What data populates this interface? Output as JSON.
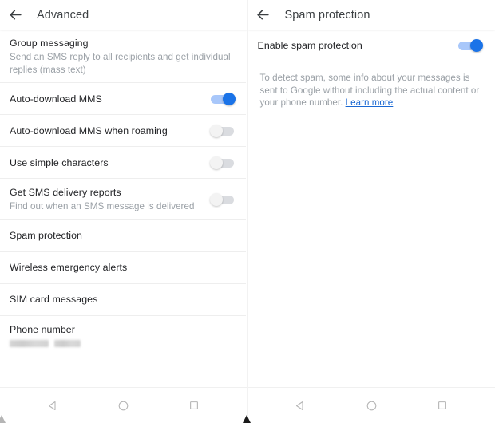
{
  "left_panel": {
    "appbar": {
      "back_icon": "arrow-back-icon",
      "title": "Advanced"
    },
    "rows": [
      {
        "name": "group-messaging",
        "title": "Group messaging",
        "subtitle": "Send an SMS reply to all recipients and get individual replies (mass text)",
        "control": "none"
      },
      {
        "name": "auto-download-mms",
        "title": "Auto-download MMS",
        "subtitle": "",
        "control": "switch",
        "switch_state": "on"
      },
      {
        "name": "auto-download-mms-roaming",
        "title": "Auto-download MMS when roaming",
        "subtitle": "",
        "control": "switch",
        "switch_state": "off"
      },
      {
        "name": "use-simple-characters",
        "title": "Use simple characters",
        "subtitle": "",
        "control": "switch",
        "switch_state": "off"
      },
      {
        "name": "get-sms-delivery-reports",
        "title": "Get SMS delivery reports",
        "subtitle": "Find out when an SMS message is delivered",
        "control": "switch",
        "switch_state": "off"
      },
      {
        "name": "spam-protection",
        "title": "Spam protection",
        "subtitle": "",
        "control": "none"
      },
      {
        "name": "wireless-emergency-alerts",
        "title": "Wireless emergency alerts",
        "subtitle": "",
        "control": "none"
      },
      {
        "name": "sim-card-messages",
        "title": "SIM card messages",
        "subtitle": "",
        "control": "none"
      },
      {
        "name": "phone-number",
        "title": "Phone number",
        "subtitle": "",
        "control": "redacted"
      }
    ]
  },
  "right_panel": {
    "appbar": {
      "back_icon": "arrow-back-icon",
      "title": "Spam protection"
    },
    "rows": [
      {
        "name": "enable-spam-protection",
        "title": "Enable spam protection",
        "subtitle": "",
        "control": "switch",
        "switch_state": "on"
      }
    ],
    "info": {
      "text": "To detect spam, some info about your messages is sent to Google without including the actual content or your phone number. ",
      "link_label": "Learn more"
    }
  },
  "navbar": {
    "back_label": "Back",
    "home_label": "Home",
    "recents_label": "Recent apps"
  },
  "colors": {
    "accent": "#1a73e8",
    "track_on": "#a8c7fa",
    "track_off": "#dadce0",
    "link": "#1967d2",
    "title_text": "#222326",
    "secondary_text": "#9aa0a6",
    "divider": "#eeeeee",
    "background": "#ffffff"
  }
}
